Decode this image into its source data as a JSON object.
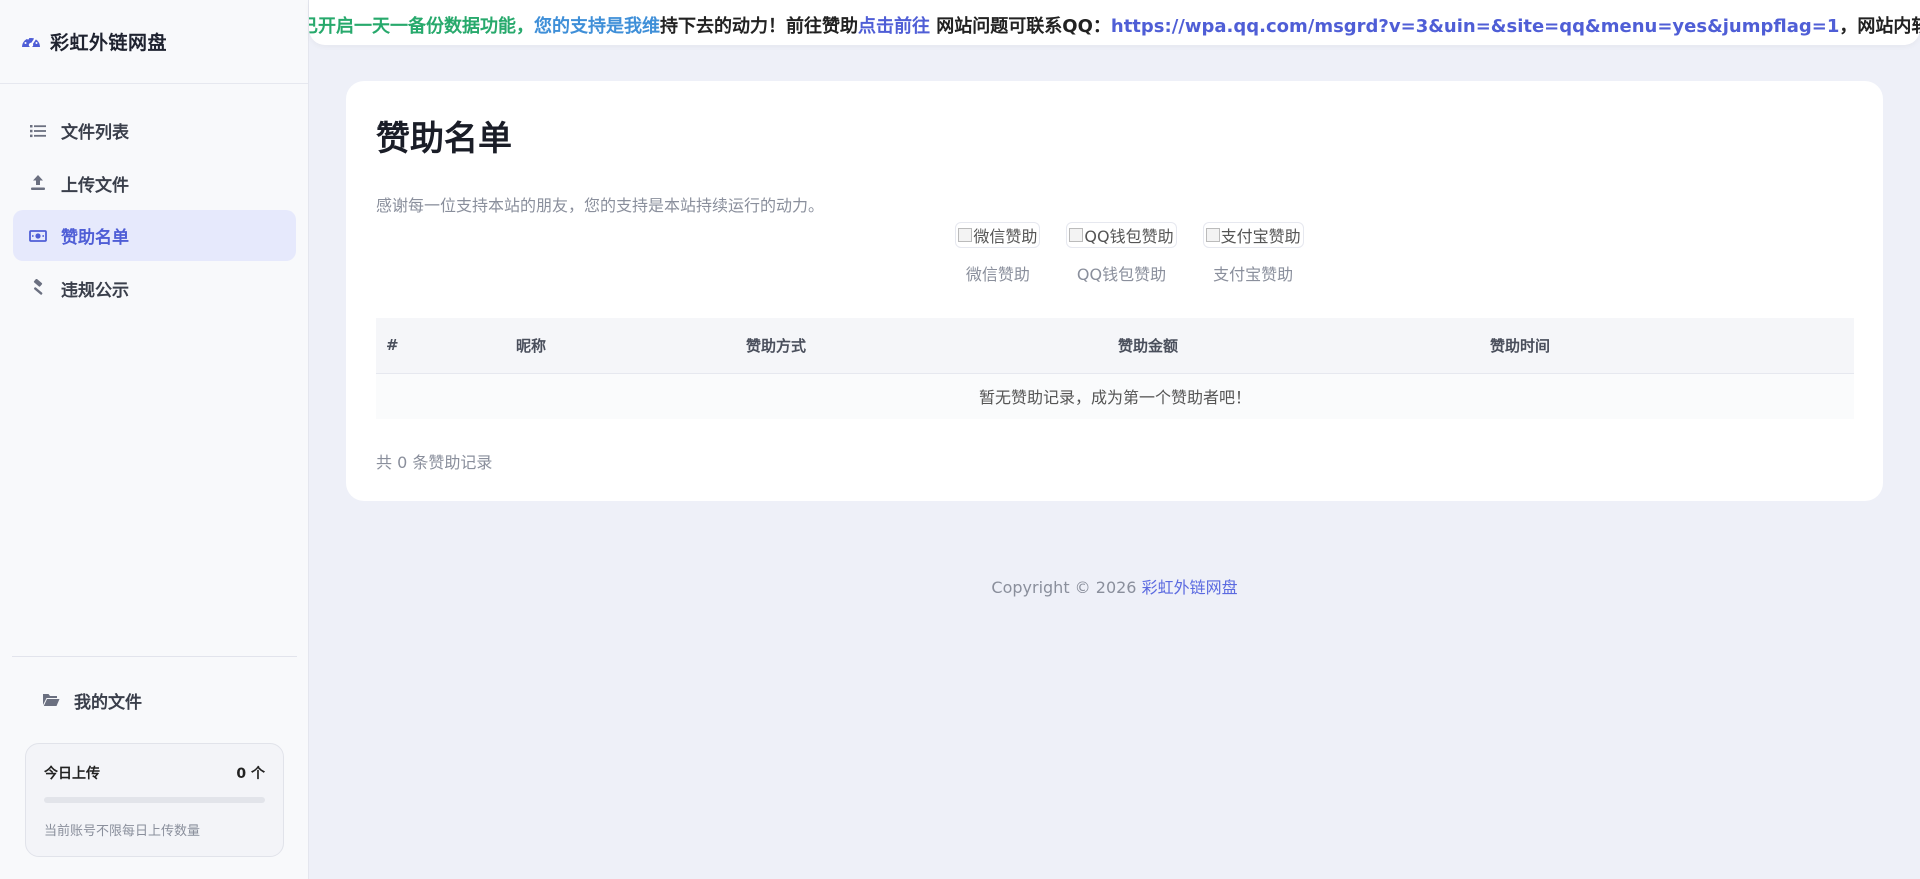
{
  "sidebar": {
    "brand": "彩虹外链网盘",
    "items": [
      {
        "label": "文件列表",
        "icon": "list-icon"
      },
      {
        "label": "上传文件",
        "icon": "upload-icon"
      },
      {
        "label": "赞助名单",
        "icon": "money-icon",
        "active": true
      },
      {
        "label": "违规公示",
        "icon": "gavel-icon"
      }
    ],
    "my_files": "我的文件",
    "quota": {
      "title": "今日上传",
      "value": "0 个",
      "progress_percent": 0,
      "note": "当前账号不限每日上传数量"
    }
  },
  "marquee": {
    "part1": "已开启一天一备份数据功能，",
    "part2": "您的支持是我维",
    "part3": "持下去的动力！前往赞助",
    "link_text": "点击前往",
    "part4": " 网站问题可联系QQ：",
    "qq_link": "https://wpa.qq.com/msgrd?v=3&uin=&site=qq&menu=yes&jumpflag=1",
    "part5": "，网站内软件等"
  },
  "main": {
    "title": "赞助名单",
    "description": "感谢每一位支持本站的朋友，您的支持是本站持续运行的动力。",
    "pay_methods": [
      {
        "alt": "微信赞助",
        "label": "微信赞助"
      },
      {
        "alt": "QQ钱包赞助",
        "label": "QQ钱包赞助"
      },
      {
        "alt": "支付宝赞助",
        "label": "支付宝赞助"
      }
    ],
    "table": {
      "headers": [
        "#",
        "昵称",
        "赞助方式",
        "赞助金额",
        "赞助时间"
      ],
      "empty_text": "暂无赞助记录，成为第一个赞助者吧！"
    },
    "total": "共 0 条赞助记录"
  },
  "footer": {
    "copyright": "Copyright © 2026 ",
    "site_link": "彩虹外链网盘"
  },
  "colors": {
    "accent": "#4f5ed6",
    "background": "#eef0f8",
    "active_bg": "#e6e9fc",
    "green_text": "#27a96c"
  }
}
